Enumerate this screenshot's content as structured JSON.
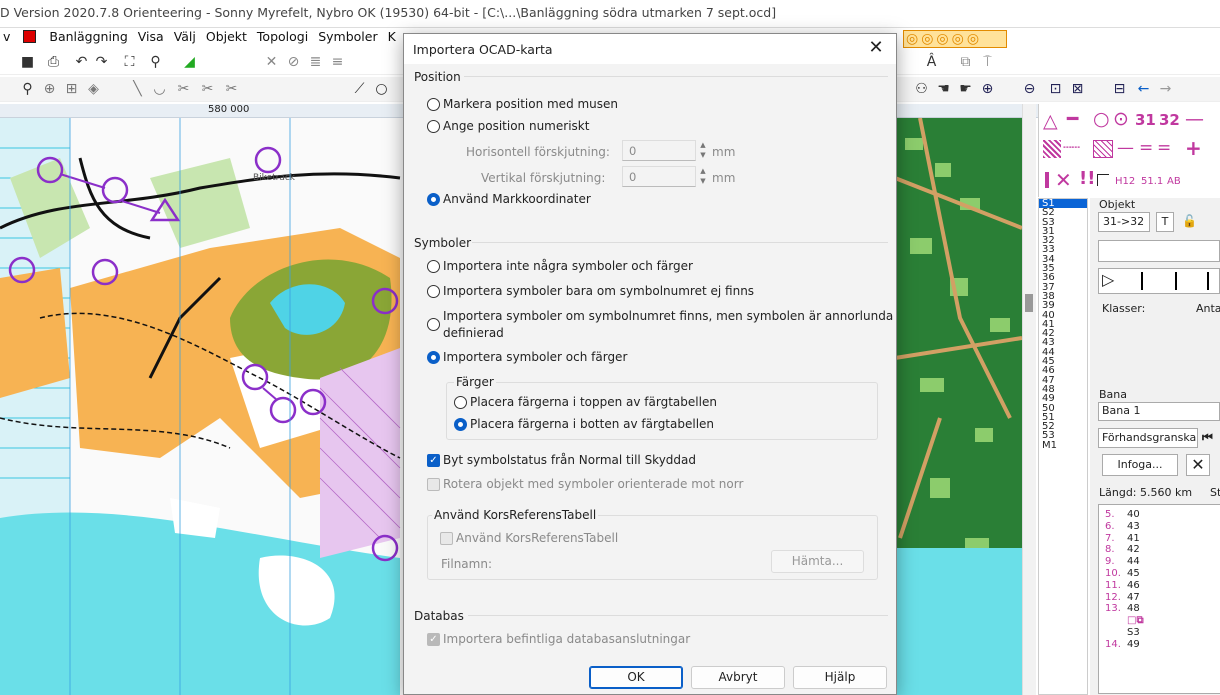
{
  "window": {
    "title": "D Version 2020.7.8 Orienteering - Sonny Myrefelt, Nybro OK (19530) 64-bit - [C:\\...\\Banläggning södra utmarken 7 sept.ocd]"
  },
  "menu": [
    "v",
    "Banläggning",
    "Visa",
    "Välj",
    "Objekt",
    "Topologi",
    "Symboler",
    "K"
  ],
  "ruler": {
    "label": "580 000"
  },
  "map": {
    "biketrack_label": "Biketrack"
  },
  "dialog": {
    "title": "Importera OCAD-karta",
    "position": {
      "header": "Position",
      "opt_mouse": "Markera position med musen",
      "opt_numeric": "Ange position numeriskt",
      "h_label": "Horisontell förskjutning:",
      "h_value": "0",
      "h_unit": "mm",
      "v_label": "Vertikal förskjutning:",
      "v_value": "0",
      "v_unit": "mm",
      "opt_coords": "Använd Markkoordinater"
    },
    "symbols": {
      "header": "Symboler",
      "opt_none": "Importera inte några symboler och färger",
      "opt_missing": "Importera symboler bara om symbolnumret ej finns",
      "opt_diff_1": "Importera symboler om symbolnumret finns, men symbolen är annorlunda",
      "opt_diff_2": "definierad",
      "opt_all": "Importera symboler och färger",
      "colors_header": "Färger",
      "opt_top": "Placera färgerna i toppen av färgtabellen",
      "opt_bottom": "Placera färgerna i botten av färgtabellen",
      "chk_protected": "Byt symbolstatus från Normal till Skyddad",
      "chk_rotate": "Rotera objekt med symboler orienterade mot norr"
    },
    "crossref": {
      "header": "Använd KorsReferensTabell",
      "chk": "Använd KorsReferensTabell",
      "file_label": "Filnamn:",
      "fetch": "Hämta..."
    },
    "database": {
      "header": "Databas",
      "chk": "Importera befintliga databasanslutningar"
    },
    "buttons": {
      "ok": "OK",
      "cancel": "Avbryt",
      "help": "Hjälp"
    }
  },
  "codes": [
    "S1",
    "S2",
    "S3",
    "31",
    "32",
    "33",
    "34",
    "35",
    "36",
    "37",
    "38",
    "39",
    "40",
    "41",
    "42",
    "43",
    "44",
    "45",
    "46",
    "47",
    "48",
    "49",
    "50",
    "51",
    "52",
    "53",
    "M1"
  ],
  "sidebar": {
    "objekt_label": "Objekt",
    "leg_value": "31->32",
    "t_btn": "T",
    "klasser": "Klasser:",
    "antal": "Anta",
    "bana_label": "Bana",
    "bana_value": "Bana 1",
    "preview": "Förhandsgranska",
    "insert": "Infoga...",
    "length": "Längd: 5.560 km",
    "st": "St",
    "legs": [
      {
        "n": "5.",
        "c": "40"
      },
      {
        "n": "6.",
        "c": "43"
      },
      {
        "n": "7.",
        "c": "41"
      },
      {
        "n": "8.",
        "c": "42"
      },
      {
        "n": "9.",
        "c": "44"
      },
      {
        "n": "10.",
        "c": "45"
      },
      {
        "n": "11.",
        "c": "46"
      },
      {
        "n": "12.",
        "c": "47"
      },
      {
        "n": "13.",
        "c": "48"
      },
      {
        "n": "",
        "c": ""
      },
      {
        "n": "",
        "c": "S3"
      },
      {
        "n": "14.",
        "c": "49"
      }
    ],
    "sym_labels": {
      "n31": "31",
      "n32": "32",
      "h12": "H12",
      "d511": "51.1",
      "ab": "AB"
    }
  }
}
